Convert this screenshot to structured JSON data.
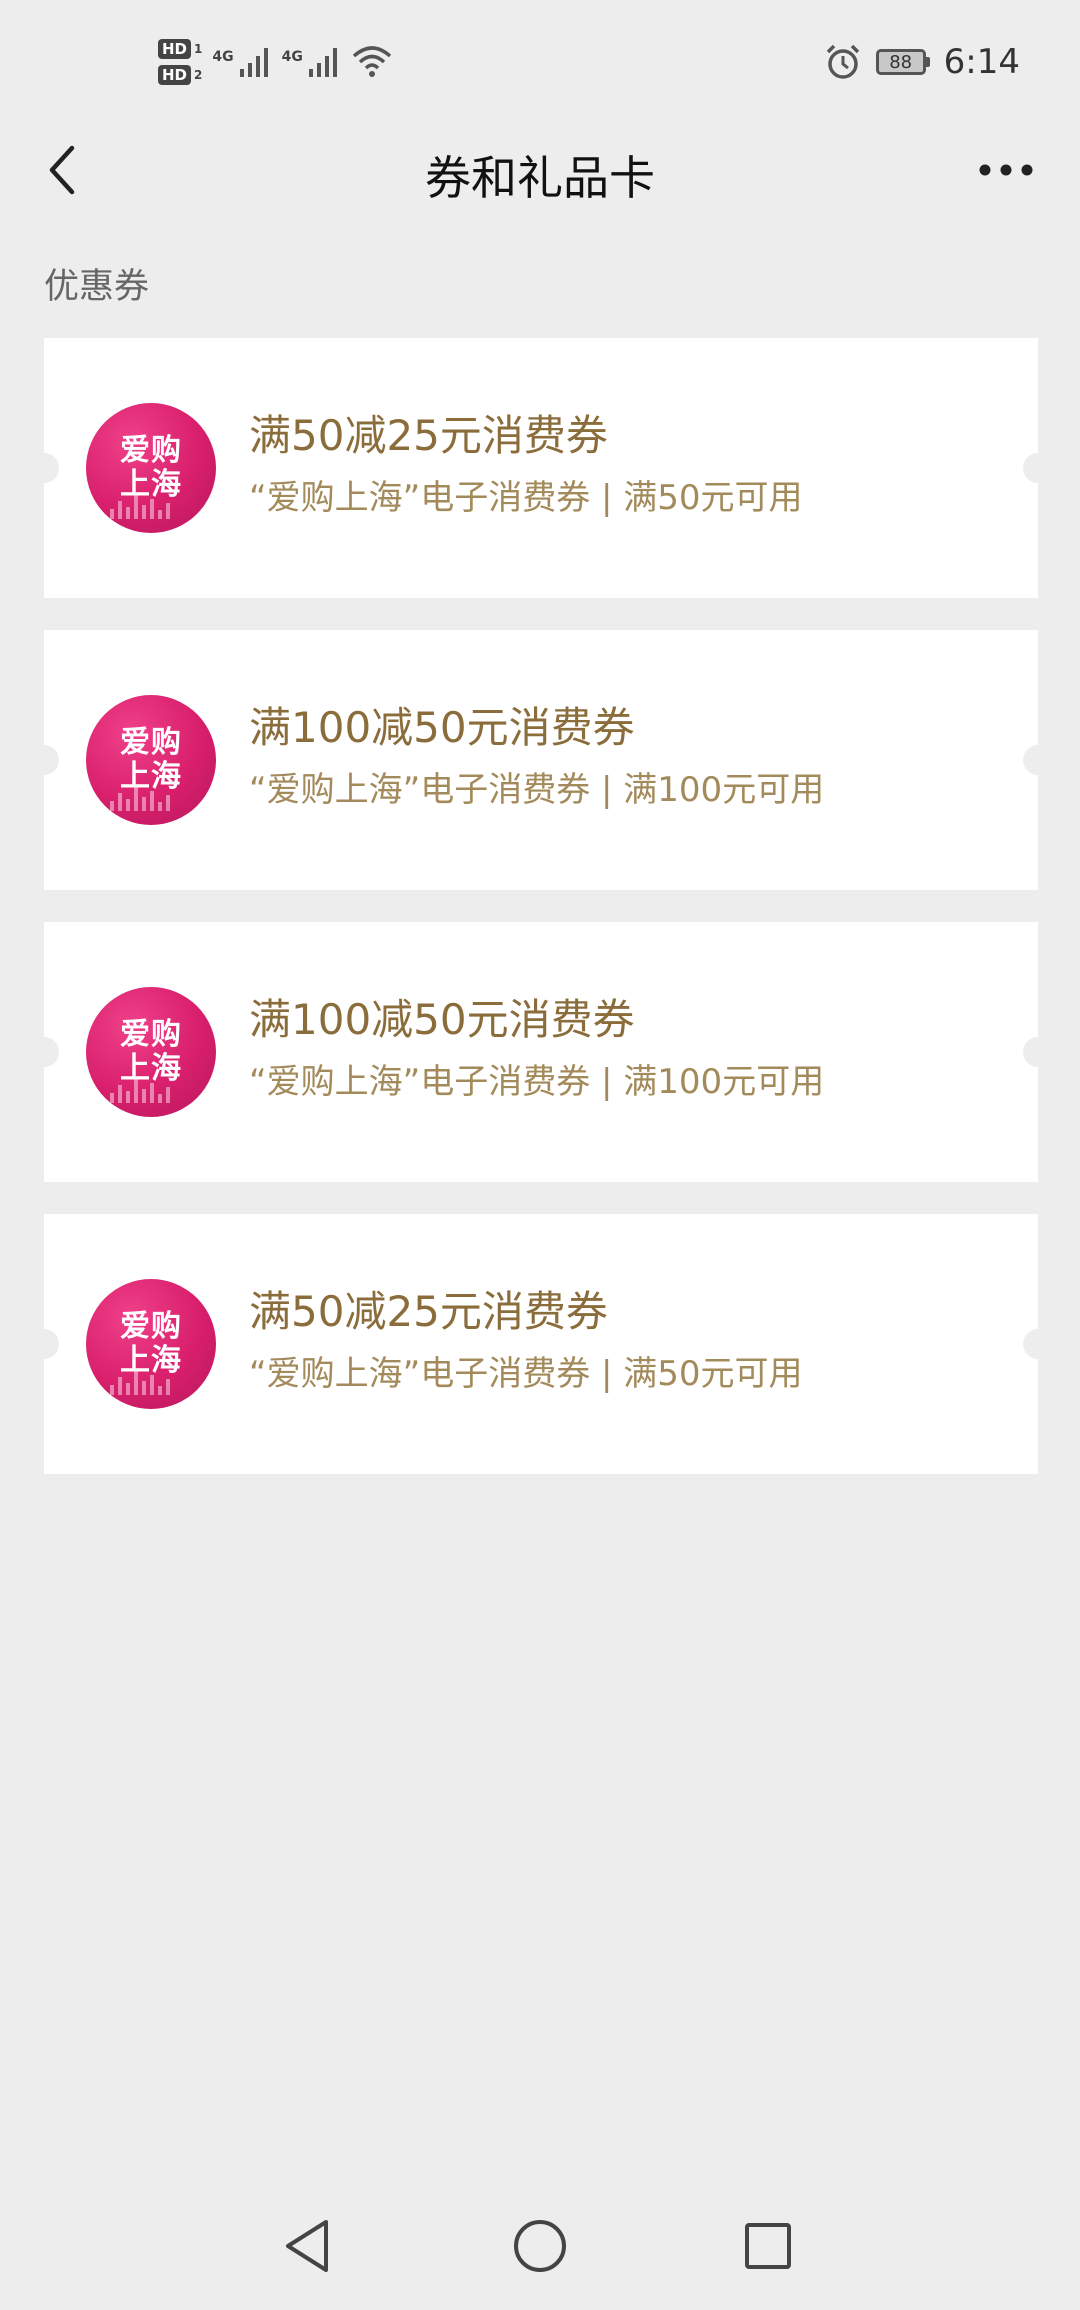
{
  "status_bar": {
    "hd1": "HD",
    "hd1_num": "1",
    "hd2": "HD",
    "hd2_num": "2",
    "net1": "4G",
    "net2": "4G",
    "battery": "88",
    "time": "6:14",
    "icons": [
      "signal-icon",
      "wifi-icon",
      "alarm-icon",
      "battery-icon"
    ]
  },
  "nav": {
    "title": "券和礼品卡",
    "back_icon": "chevron-left-icon",
    "more_icon": "more-icon"
  },
  "section": {
    "title": "优惠券"
  },
  "coupons": [
    {
      "logo_line1": "爱购",
      "logo_line2": "上海",
      "title": "满50减25元消费券",
      "desc": "“爱购上海”电子消费券 | 满50元可用"
    },
    {
      "logo_line1": "爱购",
      "logo_line2": "上海",
      "title": "满100减50元消费券",
      "desc": "“爱购上海”电子消费券 | 满100元可用"
    },
    {
      "logo_line1": "爱购",
      "logo_line2": "上海",
      "title": "满100减50元消费券",
      "desc": "“爱购上海”电子消费券 | 满100元可用"
    },
    {
      "logo_line1": "爱购",
      "logo_line2": "上海",
      "title": "满50减25元消费券",
      "desc": "“爱购上海”电子消费券 | 满50元可用"
    }
  ],
  "system_nav": {
    "back": "triangle-back-icon",
    "home": "circle-home-icon",
    "recents": "square-recents-icon"
  },
  "colors": {
    "background": "#ededed",
    "card": "#ffffff",
    "coupon_title": "#8a6d3b",
    "coupon_desc": "#a38a5a",
    "logo_pink": "#d81f6c"
  }
}
